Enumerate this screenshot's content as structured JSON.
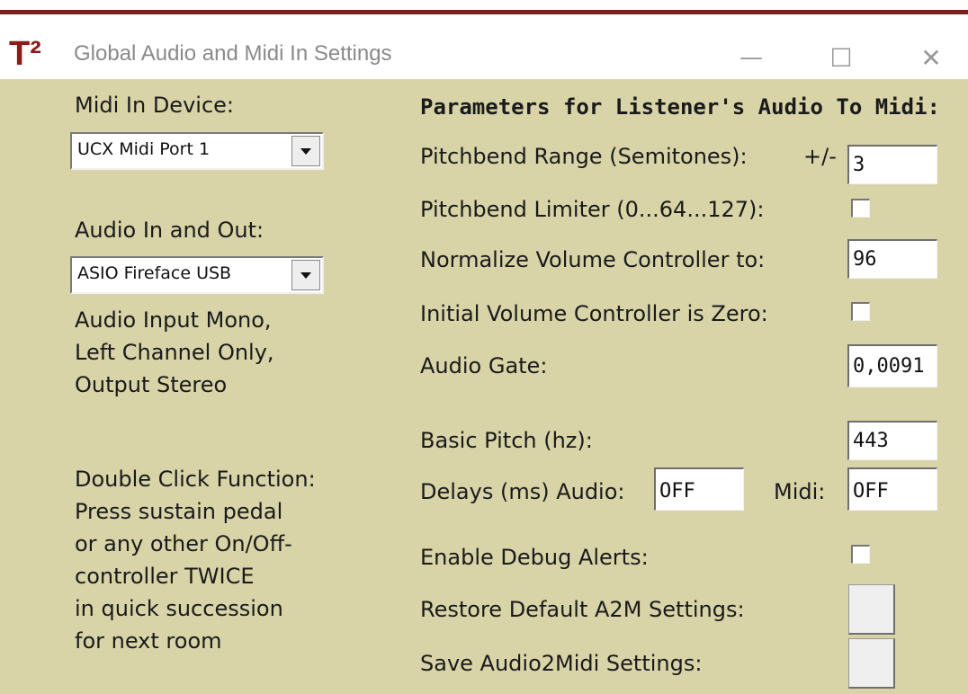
{
  "window": {
    "icon": "T²",
    "title": "Global Audio and Midi In Settings",
    "minimize": "—",
    "maximize": "☐",
    "close": "✕"
  },
  "left": {
    "midi_label": "Midi In Device:",
    "midi_value": "UCX Midi Port 1",
    "audio_label": "Audio In and Out:",
    "audio_value": "ASIO Fireface USB",
    "audio_info": [
      "Audio Input Mono,",
      "Left Channel Only,",
      "Output Stereo"
    ],
    "double_click": [
      "Double Click Function:",
      "Press sustain pedal",
      "or any other On/Off-",
      "controller TWICE",
      "in quick succession",
      "for next room"
    ]
  },
  "right": {
    "heading": "Parameters for Listener's Audio To Midi:",
    "pitchbend_range_label": "Pitchbend Range (Semitones):",
    "pitchbend_prefix": "+/-",
    "pitchbend_range_value": "3",
    "pitchbend_limiter_label": "Pitchbend Limiter (0...64...127):",
    "normalize_label": "Normalize Volume Controller to:",
    "normalize_value": "96",
    "initial_volume_label": "Initial Volume Controller is Zero:",
    "audio_gate_label": "Audio Gate:",
    "audio_gate_value": "0,0091",
    "basic_pitch_label": "Basic Pitch (hz):",
    "basic_pitch_value": "443",
    "delays_label": "Delays (ms) Audio:",
    "delay_audio_value": "OFF",
    "midi_delay_label": "Midi:",
    "delay_midi_value": "OFF",
    "debug_label": "Enable Debug Alerts:",
    "restore_label": "Restore Default A2M Settings:",
    "save_label": "Save Audio2Midi Settings:"
  }
}
